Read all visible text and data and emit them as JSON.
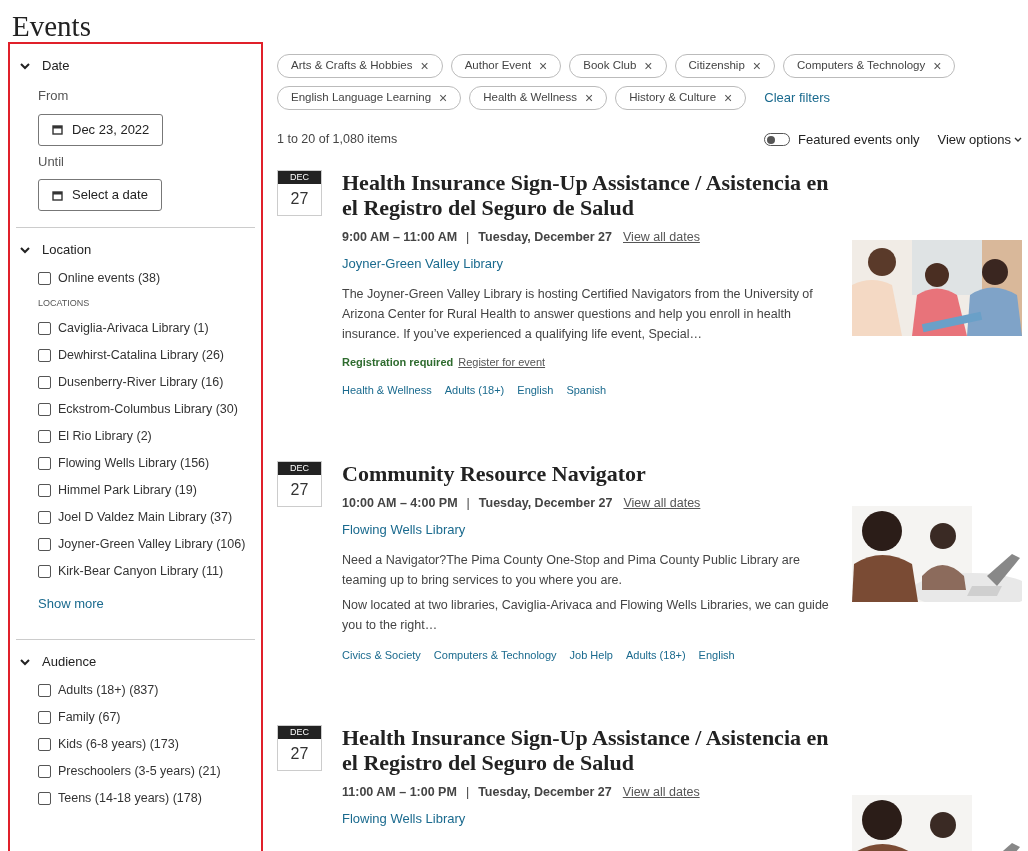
{
  "page_title": "Events",
  "filters": [
    {
      "kind": "date",
      "title": "Date",
      "expanded": true,
      "fields": [
        {
          "label": "From",
          "button": "Dec 23, 2022"
        },
        {
          "label": "Until",
          "button": "Select a date"
        }
      ]
    },
    {
      "kind": "checklist",
      "title": "Location",
      "expanded": true,
      "groups": [
        {
          "items": [
            {
              "label": "Online events (38)",
              "checked": false
            }
          ]
        },
        {
          "heading": "LOCATIONS",
          "items": [
            {
              "label": "Caviglia-Arivaca Library (1)",
              "checked": false
            },
            {
              "label": "Dewhirst-Catalina Library (26)",
              "checked": false
            },
            {
              "label": "Dusenberry-River Library (16)",
              "checked": false
            },
            {
              "label": "Eckstrom-Columbus Library (30)",
              "checked": false
            },
            {
              "label": "El Rio Library (2)",
              "checked": false
            },
            {
              "label": "Flowing Wells Library (156)",
              "checked": false
            },
            {
              "label": "Himmel Park Library (19)",
              "checked": false
            },
            {
              "label": "Joel D Valdez Main Library (37)",
              "checked": false
            },
            {
              "label": "Joyner-Green Valley Library (106)",
              "checked": false
            },
            {
              "label": "Kirk-Bear Canyon Library (11)",
              "checked": false
            }
          ]
        }
      ],
      "show_more": "Show more"
    },
    {
      "kind": "checklist",
      "title": "Audience",
      "expanded": true,
      "groups": [
        {
          "items": [
            {
              "label": "Adults (18+) (837)",
              "checked": false
            },
            {
              "label": "Family (67)",
              "checked": false
            },
            {
              "label": "Kids (6-8 years) (173)",
              "checked": false
            },
            {
              "label": "Preschoolers (3-5 years) (21)",
              "checked": false
            },
            {
              "label": "Teens (14-18 years) (178)",
              "checked": false
            }
          ]
        }
      ]
    }
  ],
  "active_filters": [
    {
      "label": "Arts & Crafts & Hobbies",
      "remove": "×"
    },
    {
      "label": "Author Event",
      "remove": "×"
    },
    {
      "label": "Book Club",
      "remove": "×"
    },
    {
      "label": "Citizenship",
      "remove": "×"
    },
    {
      "label": "Computers & Technology",
      "remove": "×"
    },
    {
      "label": "English Language Learning",
      "remove": "×"
    },
    {
      "label": "Health & Wellness",
      "remove": "×"
    },
    {
      "label": "History & Culture",
      "remove": "×"
    }
  ],
  "clear_filters": "Clear filters",
  "results_count": "1 to 20 of 1,080 items",
  "featured_toggle": {
    "label": "Featured events only",
    "on": false
  },
  "view_options": "View options",
  "events": [
    {
      "month": "DEC",
      "day": "27",
      "title": "Health Insurance Sign-Up Assistance / Asistencia en el Registro del Seguro de Salud",
      "time": "9:00 AM – 11:00 AM",
      "separator": "|",
      "date": "Tuesday, December 27",
      "view_all": "View all dates",
      "location": "Joyner-Green Valley Library",
      "description": [
        "The Joyner-Green Valley Library is hosting Certified Navigators from the University of Arizona Center for Rural Health to answer questions and help you enroll in health insurance. If you’ve experienced a qualifying life event, Special…"
      ],
      "registration": {
        "status": "Registration required",
        "link": "Register for event"
      },
      "tags": [
        "Health & Wellness",
        "Adults (18+)",
        "English",
        "Spanish"
      ],
      "picture": {
        "kind": "picture"
      }
    },
    {
      "month": "DEC",
      "day": "27",
      "title": "Community Resource Navigator",
      "time": "10:00 AM – 4:00 PM",
      "separator": "|",
      "date": "Tuesday, December 27",
      "view_all": "View all dates",
      "location": "Flowing Wells Library",
      "description": [
        "Need a Navigator?The Pima County One-Stop and Pima County Public Library are teaming up to bring services to you where you are.",
        "Now located at two libraries, Caviglia-Arivaca and Flowing Wells Libraries, we can guide you to the right…"
      ],
      "tags": [
        "Civics & Society",
        "Computers & Technology",
        "Job Help",
        "Adults (18+)",
        "English"
      ],
      "picture": {
        "kind": "picture"
      }
    },
    {
      "month": "DEC",
      "day": "27",
      "title": "Health Insurance Sign-Up Assistance / Asistencia en el Registro del Seguro de Salud",
      "time": "11:00 AM – 1:00 PM",
      "separator": "|",
      "date": "Tuesday, December 27",
      "view_all": "View all dates",
      "location": "Flowing Wells Library",
      "picture": {
        "kind": "picture"
      }
    }
  ]
}
